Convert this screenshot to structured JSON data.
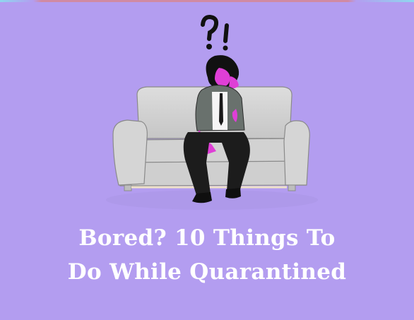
{
  "image": {
    "headline_lines": [
      "Bored? 10 Things To",
      "Do While Quarantined"
    ],
    "colors": {
      "background": "#b39df0",
      "sofa": "#d7d7d7",
      "skin": "#df3fd6",
      "suit": "#1c1c1c",
      "jacket": "#69716d",
      "text": "#ffffff"
    },
    "icons": [
      "question-mark-icon",
      "exclamation-mark-icon"
    ]
  }
}
